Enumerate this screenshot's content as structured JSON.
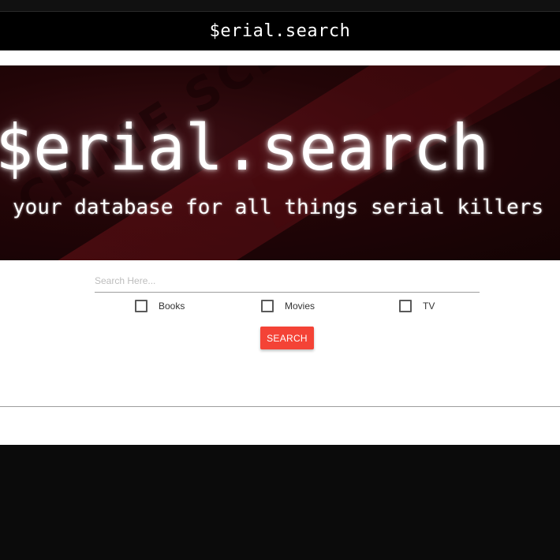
{
  "navbar": {
    "brand": "$erial.search"
  },
  "hero": {
    "background_tape_text": "CRIME SCENE DO NOT CROSS",
    "title": "$erial.search",
    "subtitle": "your database for all things serial killers"
  },
  "search": {
    "placeholder": "Search Here...",
    "value": "",
    "filters": [
      {
        "label": "Books",
        "checked": false
      },
      {
        "label": "Movies",
        "checked": false
      },
      {
        "label": "TV",
        "checked": false
      }
    ],
    "button_label": "SEARCH"
  },
  "colors": {
    "navbar_bg": "#000000",
    "accent_button": "#f44336",
    "hero_red": "#2a0609",
    "footer_bg": "#0b0b0b"
  }
}
